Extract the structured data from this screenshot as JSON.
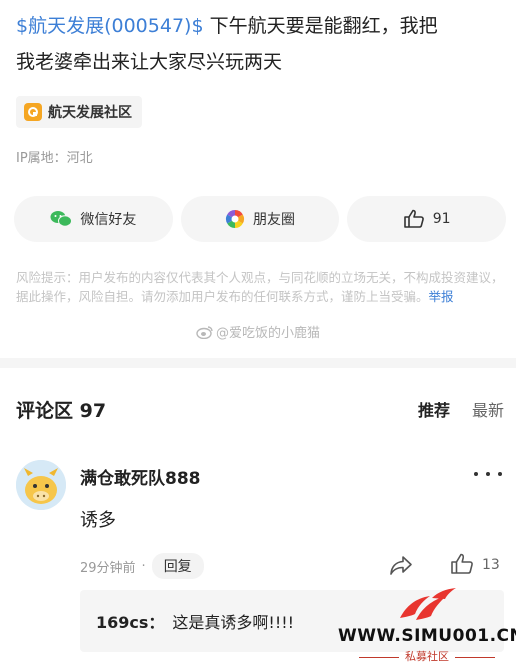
{
  "post": {
    "stock_tag": "$航天发展(000547)$",
    "body_line1": " 下午航天要是能翻红，我把",
    "body_line2": "我老婆牵出来让大家尽兴玩两天",
    "community": "航天发展社区",
    "ip": "IP属地：河北"
  },
  "share": {
    "wechat": "微信好友",
    "moments": "朋友圈",
    "likes": "91"
  },
  "risk": {
    "text": "风险提示：用户发布的内容仅代表其个人观点，与同花顺的立场无关，不构成投资建议，据此操作，风险自担。请勿添加用户发布的任何联系方式，谨防上当受骗。",
    "report": "举报"
  },
  "watermark": "@爱吃饭的小鹿猫",
  "comments": {
    "title": "评论区 97",
    "sort_hot": "推荐",
    "sort_new": "最新",
    "item": {
      "user": "满仓敢死队888",
      "text": "诱多",
      "time": "29分钟前",
      "dot": "·",
      "reply_label": "回复",
      "likes": "13",
      "sub_user": "169cs：",
      "sub_text": "这是真诱多啊!!!!"
    }
  },
  "site_logo": {
    "url": "WWW.SIMU001.CN",
    "sub": "私募社区"
  },
  "colors": {
    "link": "#3d7fd6",
    "brand_red": "#e8352f"
  }
}
